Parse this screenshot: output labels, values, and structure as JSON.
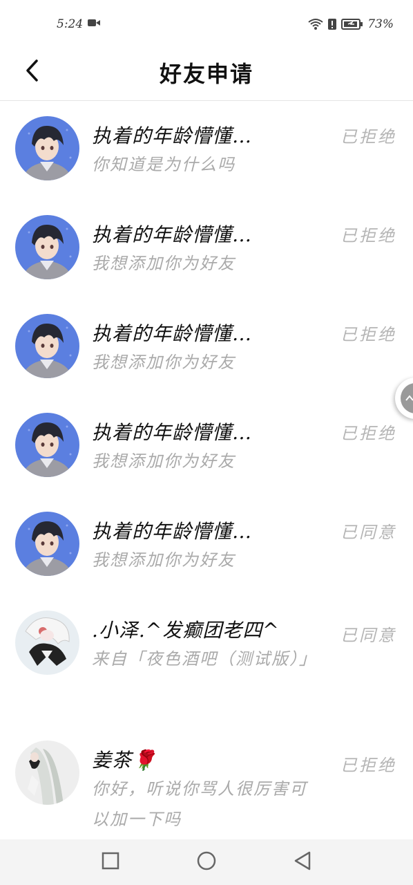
{
  "status_bar": {
    "time": "5:24",
    "battery_percent": "73%",
    "icons": [
      "video-camera-icon",
      "wifi-icon",
      "alert-icon",
      "battery-icon"
    ]
  },
  "header": {
    "title": "好友申请",
    "back_icon": "chevron-left-icon"
  },
  "requests": [
    {
      "name": "执着的年龄懵懂…",
      "message": "你知道是为什么吗",
      "status": "已拒绝",
      "avatar": "anime-boy-avatar"
    },
    {
      "name": "执着的年龄懵懂…",
      "message": "我想添加你为好友",
      "status": "已拒绝",
      "avatar": "anime-boy-avatar"
    },
    {
      "name": "执着的年龄懵懂…",
      "message": "我想添加你为好友",
      "status": "已拒绝",
      "avatar": "anime-boy-avatar"
    },
    {
      "name": "执着的年龄懵懂…",
      "message": "我想添加你为好友",
      "status": "已拒绝",
      "avatar": "anime-boy-avatar"
    },
    {
      "name": "执着的年龄懵懂…",
      "message": "我想添加你为好友",
      "status": "已同意",
      "avatar": "anime-boy-avatar"
    },
    {
      "name": ".小泽.^发癫团老四^",
      "message": "来自「夜色酒吧（测试版）」",
      "status": "已同意",
      "avatar": "white-haired-character-avatar"
    },
    {
      "name": "姜茶🌹",
      "message": "你好，听说你骂人很厉害可以加一下吗",
      "status": "已拒绝",
      "avatar": "silver-hair-character-avatar"
    }
  ],
  "nav_bar": {
    "icons": [
      "recent-apps-icon",
      "home-icon",
      "back-triangle-icon"
    ]
  },
  "colors": {
    "title_text": "#111111",
    "muted_text": "#aaaaaa",
    "status_text": "#b5b5b5",
    "avatar_bg": "#5b7fe0"
  }
}
